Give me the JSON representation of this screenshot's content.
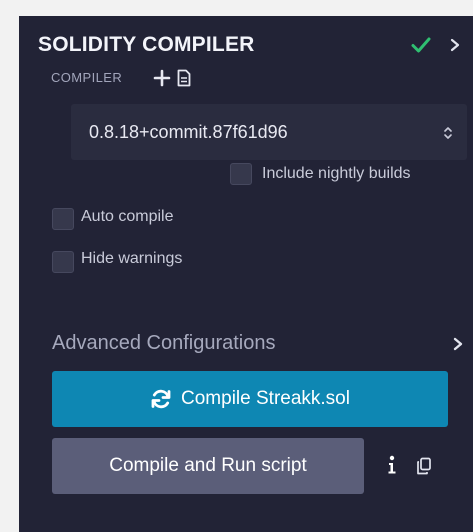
{
  "header": {
    "title": "SOLIDITY COMPILER",
    "status_icon": "check-icon",
    "expand_icon": "chevron-right-icon",
    "status_color": "#2fbf71"
  },
  "compiler": {
    "label": "COMPILER",
    "add_icon": "plus-icon",
    "file_icon": "file-icon",
    "selected_version": "0.8.18+commit.87f61d96"
  },
  "options": {
    "include_nightly_label": "Include nightly builds",
    "include_nightly_checked": false,
    "auto_compile_label": "Auto compile",
    "auto_compile_checked": false,
    "hide_warnings_label": "Hide warnings",
    "hide_warnings_checked": false
  },
  "advanced": {
    "label": "Advanced Configurations"
  },
  "actions": {
    "compile_label": "Compile Streakk.sol",
    "compile_color": "#0e87b3",
    "run_script_label": "Compile and Run script",
    "run_script_color": "#5b5e79",
    "info_icon": "info-icon",
    "copy_icon": "copy-icon"
  }
}
